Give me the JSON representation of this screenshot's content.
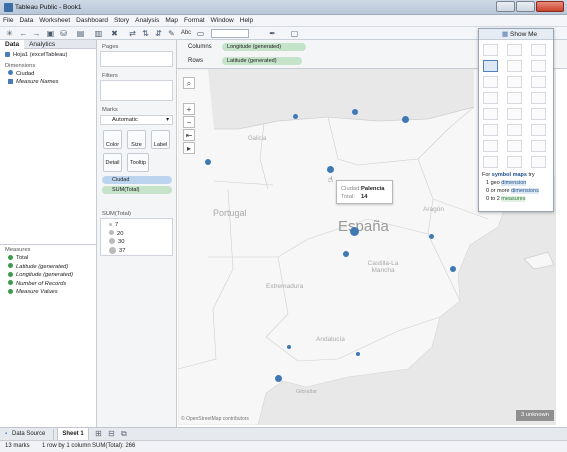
{
  "window": {
    "title": "Tableau Public - Book1"
  },
  "menu": [
    "File",
    "Data",
    "Worksheet",
    "Dashboard",
    "Story",
    "Analysis",
    "Map",
    "Format",
    "Window",
    "Help"
  ],
  "data_panel": {
    "tab_data": "Data",
    "tab_analytics": "Analytics",
    "datasource": "Hoja1 (excelTableau)",
    "dimensions_label": "Dimensions",
    "dimensions": [
      "Ciudad",
      "Measure Names"
    ],
    "measures_label": "Measures",
    "measures": [
      "Total",
      "Latitude (generated)",
      "Longitude (generated)",
      "Number of Records",
      "Measure Values"
    ]
  },
  "shelf_panel": {
    "pages": "Pages",
    "filters": "Filters",
    "marks": "Marks",
    "mark_type": "Automatic",
    "color": "Color",
    "size": "Size",
    "label": "Label",
    "detail": "Detail",
    "tooltip": "Tooltip",
    "pill_ciudad": "Ciudad",
    "pill_sum": "SUM(Total)",
    "legend_title": "SUM(Total)",
    "legend_values": [
      "7",
      "20",
      "30",
      "37"
    ]
  },
  "shelves": {
    "columns_label": "Columns",
    "columns_pill": "Longitude (generated)",
    "rows_label": "Rows",
    "rows_pill": "Latitude (generated)"
  },
  "toolbar": {
    "abc": "Abc"
  },
  "map": {
    "labels": {
      "espana": "España",
      "portugal": "Portugal",
      "galicia": "Galicia",
      "aragon": "Aragón",
      "castilla_mancha": "Castilla-La Mancha",
      "extremadura": "Extremadura",
      "andalucia": "Andalucía",
      "gibraltar": "Gibraltar"
    },
    "attribution": "© OpenStreetMap contributors",
    "unknown": "3 unknown",
    "tooltip": {
      "k1": "Ciudad:",
      "v1": "Palencia",
      "k2": "Total:",
      "v2": "14"
    }
  },
  "show_me": {
    "title": "Show Me",
    "hint1_prefix": "For ",
    "hint1_bold": "symbol maps",
    "hint1_suffix": " try",
    "hint2_prefix": "1 geo ",
    "hint2_link": "dimension",
    "hint3_prefix": "0 or more ",
    "hint3_link": "dimensions",
    "hint4_prefix": "0 to 2 ",
    "hint4_link": "measures"
  },
  "bottom_tabs": {
    "datasource": "Data Source",
    "sheet": "Sheet 1"
  },
  "status": {
    "marks": "13 marks",
    "rows": "1 row by 1 column",
    "sum": "SUM(Total): 266"
  },
  "colors": {
    "mark": "#3f78b5",
    "pill_dim": "#bcd4ee",
    "pill_meas": "#c5e3c9"
  }
}
